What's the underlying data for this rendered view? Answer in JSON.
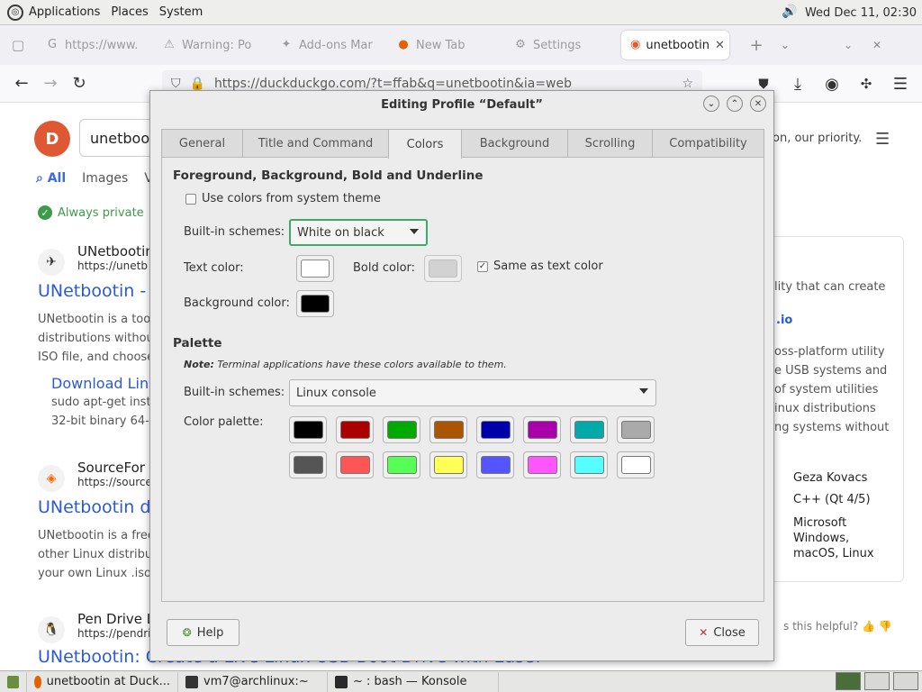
{
  "top_panel": {
    "menus": [
      "Applications",
      "Places",
      "System"
    ],
    "clock": "Wed Dec 11, 02:30"
  },
  "browser_tabs": [
    {
      "label": "https://www.",
      "icon": "globe-icon"
    },
    {
      "label": "Warning: Po",
      "icon": "warning-icon"
    },
    {
      "label": "Add-ons Mar",
      "icon": "puzzle-icon"
    },
    {
      "label": "New Tab",
      "icon": "firefox-icon"
    },
    {
      "label": "Settings",
      "icon": "gear-icon"
    },
    {
      "label": "unetbootin",
      "icon": "duckduckgo-icon",
      "active": true
    }
  ],
  "url": "https://duckduckgo.com/?t=ffab&q=unetbootin&ia=web",
  "page": {
    "search_text": "unetbooti",
    "tabs": [
      "All",
      "Images",
      "V"
    ],
    "always_private": "Always private",
    "right_header": "on, our priority.",
    "results": [
      {
        "site": "UNetbootin",
        "url": "https://unetb",
        "title": "UNetbootin -",
        "snippet": [
          "UNetbootin is a too",
          "distributions withou",
          "ISO file, and choose"
        ]
      },
      {
        "site": "SourceFor",
        "url": "https://source",
        "title": "UNetbootin d",
        "snippet": [
          "UNetbootin is a free",
          "other Linux distribut",
          "your own Linux .iso"
        ]
      },
      {
        "site": "Pen Drive L",
        "url": "https://pendri",
        "title": "UNetbootin: Create a Live Linux USB Boot Drive with Ease!",
        "snippet": []
      }
    ],
    "sub_link": "Download Linu",
    "sub_snippet": [
      "sudo apt-get insta",
      "32-bit binary 64-b"
    ],
    "right_panel": {
      "text1": "lity that can create",
      "link": ".io",
      "desc": [
        "oss-platform utility",
        "e USB systems and",
        "of system utilities",
        "inux distributions",
        "ng systems without"
      ],
      "values": [
        "Geza Kovacs",
        "C++ (Qt 4/5)",
        "Microsoft Windows, macOS, Linux"
      ]
    },
    "helpful": "s this helpful?"
  },
  "dialog": {
    "title": "Editing Profile “Default”",
    "tabs": [
      "General",
      "Title and Command",
      "Colors",
      "Background",
      "Scrolling",
      "Compatibility"
    ],
    "active_tab": "Colors",
    "section1_title": "Foreground, Background, Bold and Underline",
    "use_system_theme": "Use colors from system theme",
    "builtin_schemes_label": "Built-in schemes:",
    "builtin_scheme_value": "White on black",
    "text_color_label": "Text color:",
    "bold_color_label": "Bold color:",
    "same_as_text": "Same as text color",
    "background_color_label": "Background color:",
    "text_color": "#ffffff",
    "bold_color": "#c8c8c8",
    "background_color": "#000000",
    "palette_title": "Palette",
    "note_bold": "Note:",
    "note_text": " Terminal applications have these colors available to them.",
    "palette_schemes_label": "Built-in schemes:",
    "palette_scheme_value": "Linux console",
    "color_palette_label": "Color palette:",
    "palette_row1": [
      "#000000",
      "#aa0000",
      "#00aa00",
      "#aa5500",
      "#0000aa",
      "#aa00aa",
      "#00aaaa",
      "#aaaaaa"
    ],
    "palette_row2": [
      "#555555",
      "#ff5555",
      "#55ff55",
      "#ffff55",
      "#5555ff",
      "#ff55ff",
      "#55ffff",
      "#ffffff"
    ],
    "help_label": "Help",
    "close_label": "Close"
  },
  "taskbar": [
    {
      "label": "unetbootin at Duck...",
      "icon": "firefox-icon"
    },
    {
      "label": "vm7@archlinux:~",
      "icon": "terminal-icon"
    },
    {
      "label": "~ : bash — Konsole",
      "icon": "konsole-icon"
    }
  ]
}
